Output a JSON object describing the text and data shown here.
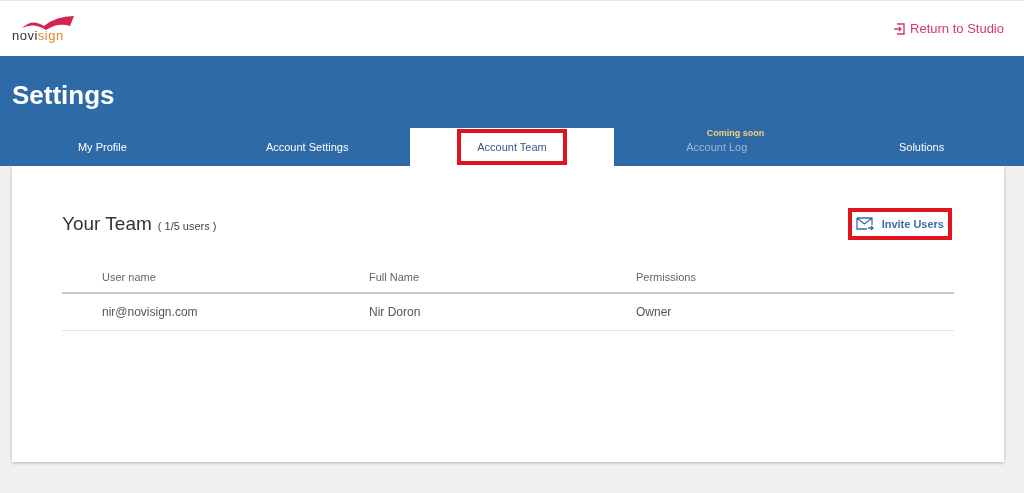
{
  "header": {
    "logo": {
      "part_1": "novi",
      "part_2": "sign"
    },
    "return_link": "Return to Studio"
  },
  "page_title": "Settings",
  "tabs": [
    {
      "label": "My Profile",
      "selected": false,
      "disabled": false,
      "highlighted": false
    },
    {
      "label": "Account Settings",
      "selected": false,
      "disabled": false,
      "highlighted": false
    },
    {
      "label": "Account Team",
      "selected": true,
      "disabled": false,
      "highlighted": true
    },
    {
      "label": "Account Log",
      "selected": false,
      "disabled": true,
      "highlighted": false,
      "note": "Coming soon"
    },
    {
      "label": "Solutions",
      "selected": false,
      "disabled": false,
      "highlighted": false
    }
  ],
  "team": {
    "title": "Your Team",
    "count": "( 1/5 users )",
    "invite_button": {
      "label": "Invite Users",
      "highlighted": true
    },
    "columns": [
      "User name",
      "Full Name",
      "Permissions"
    ],
    "rows": [
      [
        "nir@novisign.com",
        "Nir Doron",
        "Owner"
      ]
    ]
  }
}
